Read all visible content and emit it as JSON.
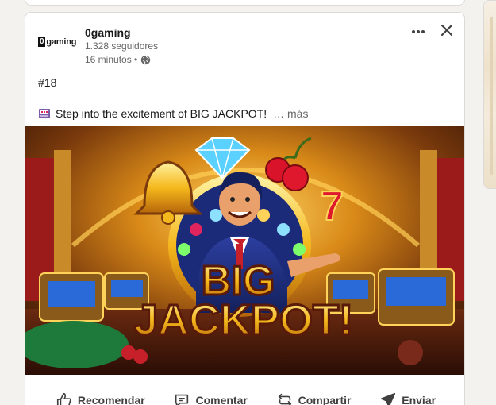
{
  "author": {
    "logo_text": "gaming",
    "logo_zero": "0",
    "name": "0gaming",
    "followers": "1.328 seguidores",
    "time": "16 minutos •"
  },
  "post": {
    "hashtag": "#18",
    "text": "Step into the excitement of BIG JACKPOT!",
    "more": "… más",
    "image_text": {
      "line1": "BIG",
      "line2": "JACKPOT!",
      "seven": "7"
    }
  },
  "actions": {
    "like": "Recomendar",
    "comment": "Comentar",
    "share": "Compartir",
    "send": "Enviar"
  },
  "icons": {
    "more": "more-horizontal-icon",
    "close": "close-icon",
    "globe": "globe-icon",
    "slot": "slot-machine-icon",
    "like": "thumbs-up-icon",
    "comment": "comment-icon",
    "share": "repost-icon",
    "send": "send-icon"
  },
  "colors": {
    "background": "#f4f2ee",
    "card": "#ffffff",
    "text": "#191919",
    "muted": "#666666",
    "gold": "#f5b81c",
    "navy": "#1c2a7a"
  }
}
